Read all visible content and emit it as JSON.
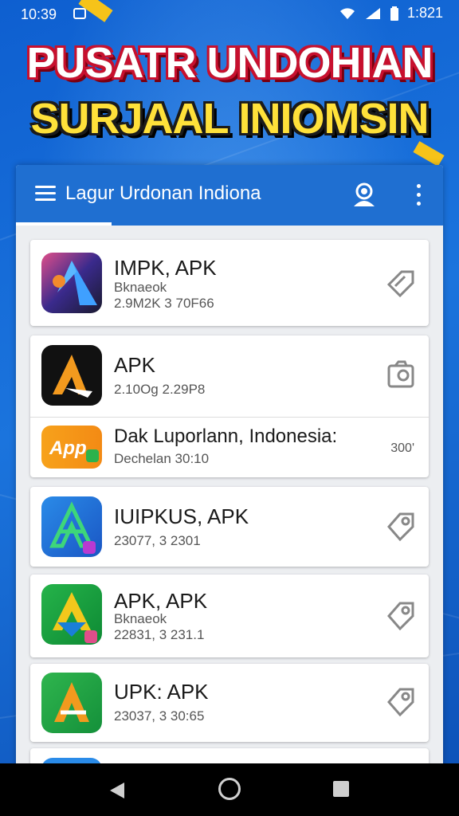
{
  "status_bar": {
    "time": "10:39",
    "clock": "1:821"
  },
  "banner": {
    "line1": "PUSATR UNDOHIAN",
    "line2": "SURJAAL INIOMSIN"
  },
  "app_bar": {
    "title": "Lagur Urdonan Indiona"
  },
  "colors": {
    "accent": "#1f6fd1",
    "banner_red": "#c8102e",
    "banner_yellow": "#ffe13a"
  },
  "items": [
    {
      "title": "IMPK, APK",
      "subtitle": "Bknaeok",
      "meta": "2.9M2K 3 70F66",
      "icon": "apk-blue-triangle-icon",
      "action_icon": "tag-icon"
    },
    {
      "title": "APK",
      "meta": "2.10Og 2.29P8",
      "icon": "apk-black-a-icon",
      "action_icon": "photo-tag-icon"
    },
    {
      "title": "Dak Luporlann, Indonesia:",
      "meta": "Dechelan 30:10",
      "value": "300'",
      "icon": "app-orange-icon"
    },
    {
      "title": "IUIPKUS, APK",
      "meta": "23077, 3 2301",
      "icon": "apk-blue-green-icon",
      "action_icon": "tag-icon"
    },
    {
      "title": "APK, APK",
      "subtitle": "Bknaeok",
      "meta": "22831, 3 231.1",
      "icon": "apk-green-icon",
      "action_icon": "tag-icon"
    },
    {
      "title": "UPK: APK",
      "meta": "23037, 3 30:65",
      "icon": "apk-green-a-icon",
      "action_icon": "tag-icon"
    }
  ]
}
